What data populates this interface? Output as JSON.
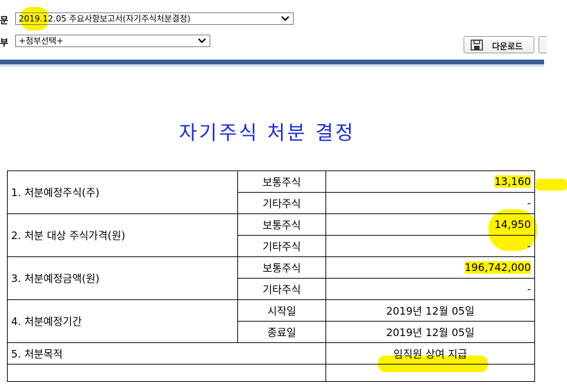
{
  "toolbar": {
    "doc_label": "문",
    "doc_select": "2019.12.05  주요사항보고서(자기주식처분결정)",
    "attach_label": "부",
    "attach_select": "+첨부선택+",
    "download_label": "다운로드"
  },
  "title": "자기주식 처분 결정",
  "table": {
    "rows": [
      {
        "label": "1. 처분예정주식(주)",
        "sub1": "보통주식",
        "val1": "13,160",
        "sub2": "기타주식",
        "val2": "-"
      },
      {
        "label": "2. 처분 대상 주식가격(원)",
        "sub1": "보통주식",
        "val1": "14,950",
        "sub2": "기타주식",
        "val2": "-"
      },
      {
        "label": "3. 처분예정금액(원)",
        "sub1": "보통주식",
        "val1": "196,742,000",
        "sub2": "기타주식",
        "val2": "-"
      },
      {
        "label": "4. 처분예정기간",
        "sub1": "시작일",
        "val1": "2019년 12월 05일",
        "sub2": "종료일",
        "val2": "2019년 12월 05일"
      }
    ],
    "purpose_label": "5. 처분목적",
    "purpose_value": "임직원 상여 지급"
  },
  "colors": {
    "highlight": "#fff200",
    "title": "#1a2bd0",
    "divider": "#3a5f9b"
  },
  "icons": [
    "chevron-down-icon",
    "save-disk-icon"
  ]
}
